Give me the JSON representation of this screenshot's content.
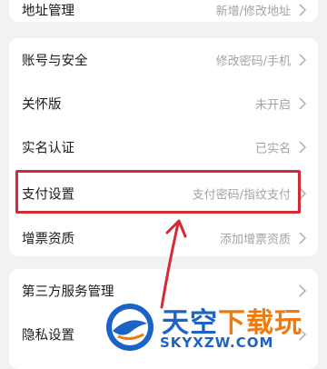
{
  "settings": {
    "top_row": {
      "label": "地址管理",
      "value": "新增/修改地址"
    },
    "group1": [
      {
        "key": "account",
        "label": "账号与安全",
        "value": "修改密码/手机"
      },
      {
        "key": "care",
        "label": "关怀版",
        "value": "未开启"
      },
      {
        "key": "realname",
        "label": "实名认证",
        "value": "已实名"
      },
      {
        "key": "payment",
        "label": "支付设置",
        "value": "支付密码/指纹支付"
      },
      {
        "key": "invoice",
        "label": "增票资质",
        "value": "添加增票资质"
      }
    ],
    "group2": [
      {
        "key": "third-party",
        "label": "第三方服务管理",
        "value": ""
      },
      {
        "key": "privacy",
        "label": "隐私设置",
        "value": ""
      }
    ]
  },
  "annotation": {
    "highlight_color": "#d42a35"
  },
  "watermark": {
    "brand_part1": "天空",
    "brand_part2": "下载玩",
    "url": "SKYXZW.COM"
  },
  "colors": {
    "background": "#f2f2f2",
    "card": "#ffffff",
    "label": "#1a1a1a",
    "value": "#a3a3a3"
  }
}
